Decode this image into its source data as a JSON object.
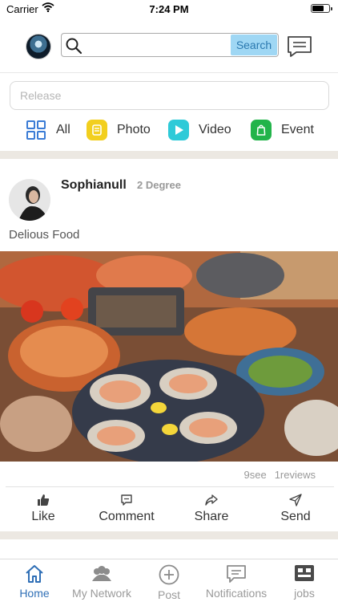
{
  "status_bar": {
    "carrier": "Carrier",
    "time": "7:24 PM"
  },
  "header": {
    "search": {
      "value": "",
      "placeholder": "",
      "button_label": "Search"
    }
  },
  "composer": {
    "placeholder": "Release"
  },
  "filters": [
    {
      "label": "All",
      "icon": "grid-icon",
      "color": "#3a7bd5"
    },
    {
      "label": "Photo",
      "icon": "photo-icon",
      "color": "#f2cf1e"
    },
    {
      "label": "Video",
      "icon": "play-icon",
      "color": "#2ecad8"
    },
    {
      "label": "Event",
      "icon": "event-icon",
      "color": "#22b44a"
    }
  ],
  "post": {
    "user_name": "Sophianull",
    "degree": "2 Degree",
    "text": "Delious Food",
    "image": "seafood-platter-photo",
    "stats": {
      "views": "9see",
      "reviews": "1reviews"
    },
    "actions": [
      {
        "label": "Like",
        "icon": "thumbs-up-icon"
      },
      {
        "label": "Comment",
        "icon": "comment-icon"
      },
      {
        "label": "Share",
        "icon": "share-icon"
      },
      {
        "label": "Send",
        "icon": "send-icon"
      }
    ]
  },
  "tab_bar": {
    "active_color": "#2f6fb6",
    "items": [
      {
        "label": "Home",
        "icon": "home-icon",
        "active": true
      },
      {
        "label": "My Network",
        "icon": "network-icon",
        "active": false
      },
      {
        "label": "Post",
        "icon": "plus-circle-icon",
        "active": false
      },
      {
        "label": "Notifications",
        "icon": "notifications-icon",
        "active": false
      },
      {
        "label": "jobs",
        "icon": "jobs-icon",
        "active": false
      }
    ]
  }
}
